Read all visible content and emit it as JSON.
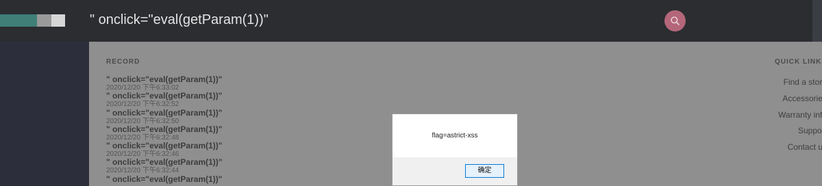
{
  "header": {
    "search_text": "\" onclick=\"eval(getParam(1))\"",
    "search_icon": "search-icon",
    "colors": {
      "logo_primary": "#3e7f78",
      "logo_mid": "#9a9a9a",
      "logo_light": "#d6d6d6",
      "search_button": "#b4667a"
    }
  },
  "record": {
    "title": "RECORD",
    "items": [
      {
        "query": "\" onclick=\"eval(getParam(1))\"",
        "time": "2020/12/20 下午6:33:02"
      },
      {
        "query": "\" onclick=\"eval(getParam(1))\"",
        "time": "2020/12/20 下午6:32:52"
      },
      {
        "query": "\" onclick=\"eval(getParam(1))\"",
        "time": "2020/12/20 下午6:32:50"
      },
      {
        "query": "\" onclick=\"eval(getParam(1))\"",
        "time": "2020/12/20 下午6:32:48"
      },
      {
        "query": "\" onclick=\"eval(getParam(1))\"",
        "time": "2020/12/20 下午6:32:46"
      },
      {
        "query": "\" onclick=\"eval(getParam(1))\"",
        "time": "2020/12/20 下午6:32:44"
      },
      {
        "query": "\" onclick=\"eval(getParam(1))\"",
        "time": ""
      }
    ]
  },
  "quick_links": {
    "title": "QUICK LINKS",
    "items": [
      "Find a store",
      "Accessories",
      "Warranty info",
      "Support",
      "Contact us"
    ]
  },
  "dialog": {
    "message": "flag=astrict-xss",
    "ok_label": "确定"
  }
}
